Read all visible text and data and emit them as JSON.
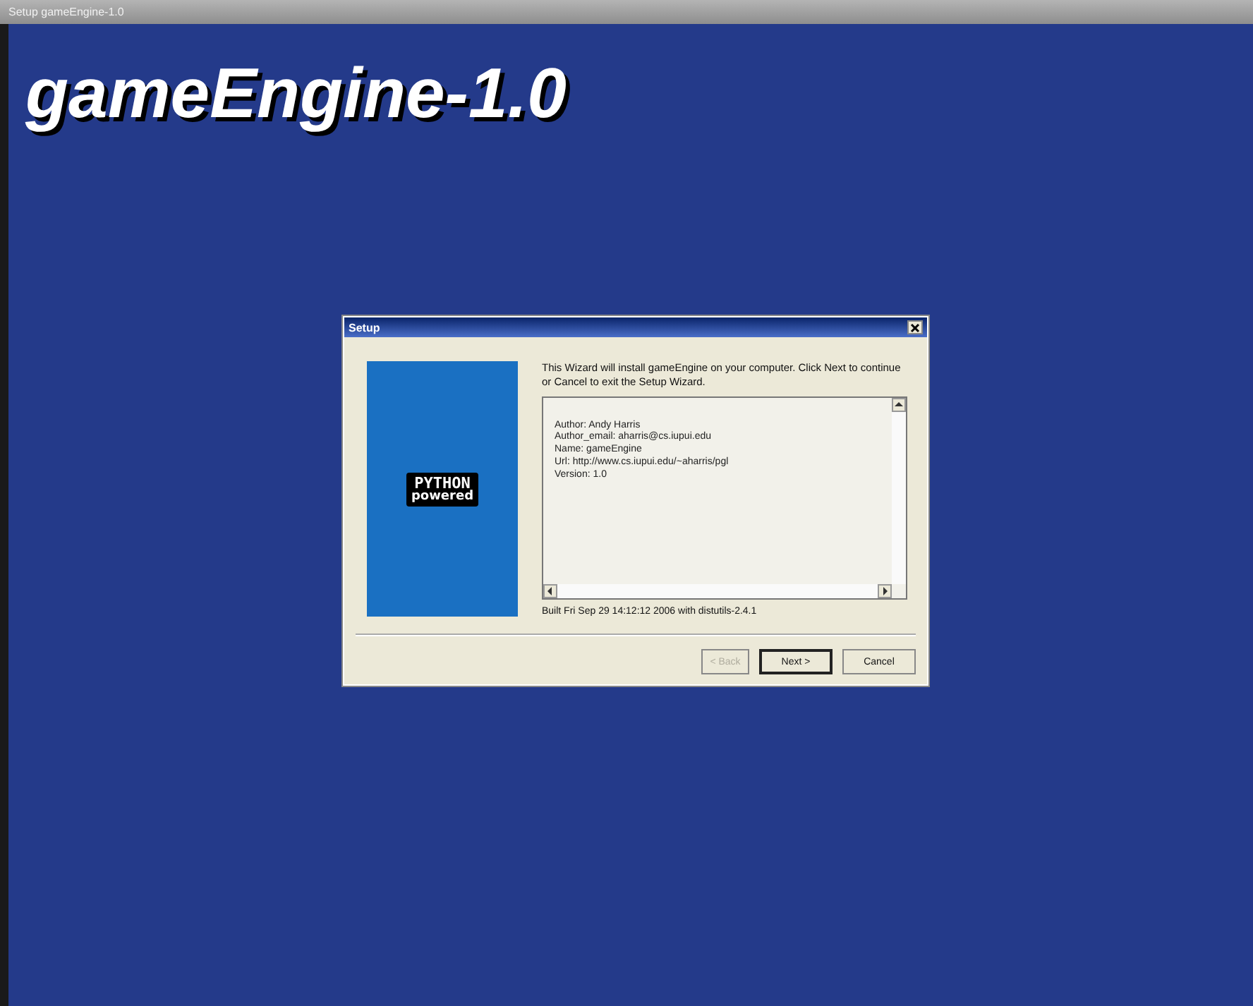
{
  "window": {
    "title": "Setup gameEngine-1.0"
  },
  "heading": "gameEngine-1.0",
  "dialog": {
    "title": "Setup",
    "side_logo": [
      "PYTHON",
      "powered"
    ],
    "intro": "This Wizard will install gameEngine on your computer. Click Next to continue or Cancel to exit the Setup Wizard.",
    "info_lines": [
      "Author: Andy Harris",
      "Author_email: aharris@cs.iupui.edu",
      "Name: gameEngine",
      "Url: http://www.cs.iupui.edu/~aharris/pgl",
      "Version: 1.0"
    ],
    "build_note": "Built Fri Sep 29 14:12:12 2006 with distutils-2.4.1",
    "buttons": [
      {
        "label": "< Back",
        "disabled": true,
        "default": false
      },
      {
        "label": "Next >",
        "disabled": false,
        "default": true
      },
      {
        "label": "Cancel",
        "disabled": false,
        "default": false
      }
    ]
  }
}
